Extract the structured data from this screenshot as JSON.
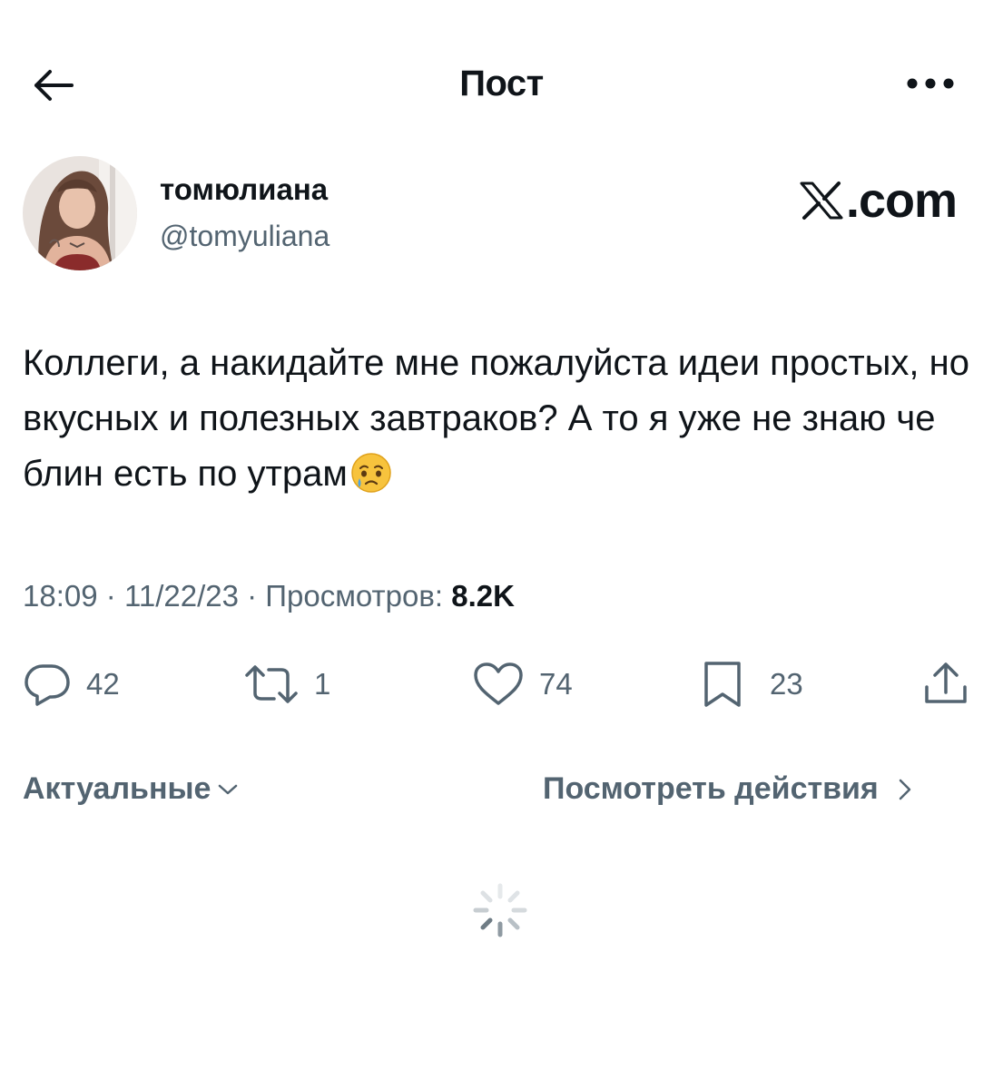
{
  "header": {
    "title": "Пост"
  },
  "author": {
    "display_name": "томюлиана",
    "handle": "@tomyuliana",
    "watermark": ".com"
  },
  "tweet": {
    "text": "Коллеги, а накидайте мне пожалуйста идеи простых, но вкусных и полезных завтраков? А то я уже не знаю че блин есть по утрам",
    "emoji": "face-holding-back-tears",
    "time": "18:09",
    "date": "11/22/23",
    "separator": "·",
    "views_label": "Просмотров:",
    "views_count": "8.2K"
  },
  "actions": {
    "replies": "42",
    "reposts": "1",
    "likes": "74",
    "bookmarks": "23"
  },
  "footer": {
    "sort_label": "Актуальные",
    "activity_label": "Посмотреть действия"
  },
  "colors": {
    "text": "#0f1419",
    "secondary": "#536471",
    "background": "#ffffff"
  },
  "icons": [
    "back-arrow-icon",
    "more-dots-icon",
    "x-logo-icon",
    "reply-icon",
    "repost-icon",
    "like-icon",
    "bookmark-icon",
    "share-icon",
    "chevron-down-icon",
    "chevron-right-icon",
    "loading-spinner-icon"
  ]
}
